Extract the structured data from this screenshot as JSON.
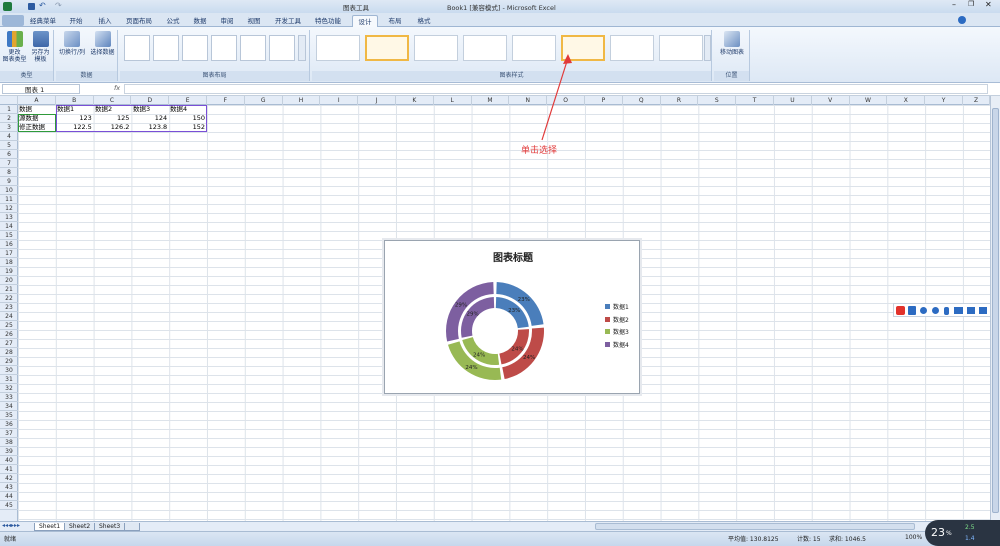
{
  "window": {
    "title": "Book1 [兼容模式] - Microsoft Excel",
    "context_tab": "图表工具"
  },
  "tabs": [
    "经典菜单",
    "开始",
    "插入",
    "页面布局",
    "公式",
    "数据",
    "审阅",
    "视图",
    "开发工具",
    "特色功能",
    "设计",
    "布局",
    "格式"
  ],
  "ribbon": {
    "groups": [
      {
        "label": "类型"
      },
      {
        "label": "数据"
      },
      {
        "label": "图表布局"
      },
      {
        "label": "图表样式"
      },
      {
        "label": "位置"
      }
    ],
    "buttons": {
      "change_type_1": "更改",
      "change_type_2": "图表类型",
      "save_template_1": "另存为",
      "save_template_2": "模板",
      "switch_row_col": "切换行/列",
      "select_data": "选择数据",
      "move_chart": "移动图表"
    }
  },
  "formula_bar": {
    "name_box": "图表 1",
    "fx": "fx"
  },
  "columns": [
    "A",
    "B",
    "C",
    "D",
    "E",
    "F",
    "G",
    "H",
    "I",
    "J",
    "K",
    "L",
    "M",
    "N",
    "O",
    "P",
    "Q",
    "R",
    "S",
    "T",
    "U",
    "V",
    "W",
    "X",
    "Y",
    "Z"
  ],
  "rows": [
    "1",
    "2",
    "3",
    "4",
    "5",
    "6",
    "7",
    "8",
    "9",
    "10",
    "11",
    "12",
    "13",
    "14",
    "15",
    "16",
    "17",
    "18",
    "19",
    "20",
    "21",
    "22",
    "23",
    "24",
    "25",
    "26",
    "27",
    "28",
    "29",
    "30",
    "31",
    "32",
    "33",
    "34",
    "35",
    "36",
    "37",
    "38",
    "39",
    "40",
    "41",
    "42",
    "43",
    "44",
    "45"
  ],
  "sheet_data": {
    "r1": [
      "数据",
      "数据1",
      "数据2",
      "数据3",
      "数据4"
    ],
    "r2": [
      "源数据",
      "123",
      "125",
      "124",
      "150"
    ],
    "r3": [
      "修正数据",
      "122.5",
      "126.2",
      "123.8",
      "152"
    ]
  },
  "annotation": "单击选择",
  "chart": {
    "title": "图表标题",
    "legend": [
      "数据1",
      "数据2",
      "数据3",
      "数据4"
    ],
    "inner_labels": [
      "23%",
      "24%",
      "24%",
      "29%"
    ],
    "outer_labels": [
      "23%",
      "24%",
      "24%",
      "29%"
    ]
  },
  "chart_data": {
    "type": "doughnut",
    "title": "图表标题",
    "categories": [
      "数据1",
      "数据2",
      "数据3",
      "数据4"
    ],
    "series": [
      {
        "values": [
          123,
          125,
          124,
          150
        ]
      },
      {
        "values": [
          122.5,
          126.2,
          123.8,
          152
        ]
      }
    ],
    "colors": [
      "#4a7ebb",
      "#be4b48",
      "#98b954",
      "#7d5fa0"
    ],
    "legend_position": "right"
  },
  "sheets": [
    "Sheet1",
    "Sheet2",
    "Sheet3"
  ],
  "status": {
    "ready": "就绪",
    "average": "平均值: 130.8125",
    "count": "计数: 15",
    "sum": "求和: 1046.5",
    "zoom": "100%"
  },
  "widget": {
    "value": "23",
    "unit": "%",
    "up": "2.5",
    "down": "1.4"
  }
}
